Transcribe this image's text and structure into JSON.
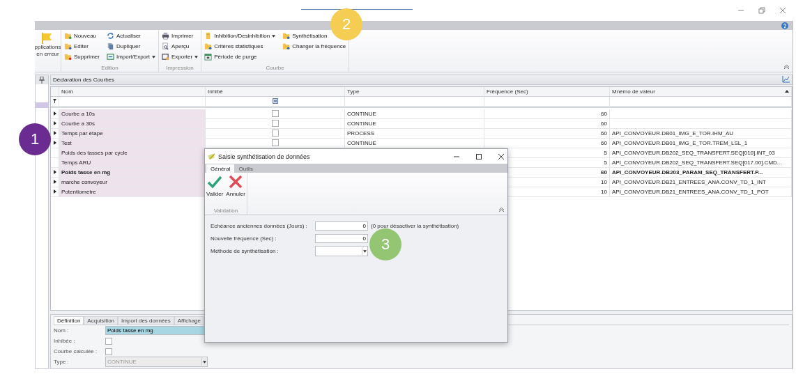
{
  "ribbon": {
    "left_button": {
      "lines": [
        "pplications",
        "en erreur"
      ]
    },
    "groups": [
      {
        "label": "Edition",
        "columns": [
          [
            {
              "label": "Nouveau",
              "dropdown": false
            },
            {
              "label": "Editer",
              "dropdown": false
            },
            {
              "label": "Supprimer",
              "dropdown": false
            }
          ],
          [
            {
              "label": "Actualiser",
              "dropdown": false
            },
            {
              "label": "Dupliquer",
              "dropdown": false
            },
            {
              "label": "Import/Export",
              "dropdown": true
            }
          ]
        ]
      },
      {
        "label": "Impression",
        "columns": [
          [
            {
              "label": "Imprimer",
              "dropdown": false
            },
            {
              "label": "Aperçu",
              "dropdown": false
            },
            {
              "label": "Exporter",
              "dropdown": true
            }
          ]
        ]
      },
      {
        "label": "Courbe",
        "columns": [
          [
            {
              "label": "Inhibition/Desinhibition",
              "dropdown": true
            },
            {
              "label": "Critères statistiques",
              "dropdown": false
            },
            {
              "label": "Période de purge",
              "dropdown": false
            }
          ],
          [
            {
              "label": "Synthétisation",
              "dropdown": false
            },
            {
              "label": "Changer la fréquence",
              "dropdown": false
            }
          ]
        ]
      }
    ]
  },
  "panel": {
    "title": "Déclaration des Courbes"
  },
  "grid": {
    "columns": [
      "Nom",
      "Inhibé",
      "Type",
      "Fréquence (Sec)",
      "Mnémo de valeur"
    ],
    "rows": [
      {
        "name": "Courbe a 10s",
        "expandable": true,
        "selected": false,
        "inhibited": false,
        "type": "CONTINUE",
        "frequency": "60"
      },
      {
        "name": "Courbe a 30s",
        "expandable": true,
        "selected": false,
        "inhibited": false,
        "type": "CONTINUE",
        "frequency": "60"
      },
      {
        "name": "Temps par étape",
        "expandable": true,
        "selected": false,
        "inhibited": false,
        "type": "PROCESS",
        "frequency": "60",
        "mnemo": "API_CONVOYEUR.DB01_IMG_E_TOR.IHM_AU"
      },
      {
        "name": "Test",
        "expandable": true,
        "selected": false,
        "inhibited": false,
        "type": "CONTINUE",
        "frequency": "60",
        "mnemo": "API_CONVOYEUR.DB01_IMG_E_TOR.TREM_LSL_1"
      },
      {
        "name": "Poids des tasses par cycle",
        "expandable": false,
        "selected": false,
        "frequency": "5",
        "mnemo": "API_CONVOYEUR.DB202_SEQ_TRANSFERT.SEQ[010].INT_03"
      },
      {
        "name": "Temps ARU",
        "expandable": false,
        "selected": false,
        "frequency": "5",
        "mnemo": "API_CONVOYEUR.DB202_SEQ_TRANSFERT.SEQ[017.00].CMD..."
      },
      {
        "name": "Poids tasse en mg",
        "expandable": true,
        "selected": true,
        "frequency": "60",
        "mnemo": "API_CONVOYEUR.DB203_PARAM_SEQ_TRANSFERT.P..."
      },
      {
        "name": "marche convoyeur",
        "expandable": true,
        "selected": false,
        "frequency": "10",
        "mnemo": "API_CONVOYEUR.DB21_ENTREES_ANA.CONV_TD_1_INT"
      },
      {
        "name": "Potentiometre",
        "expandable": true,
        "selected": false,
        "frequency": "10",
        "mnemo": "API_CONVOYEUR.DB21_ENTREES_ANA.CONV_TD_1_POT"
      }
    ]
  },
  "details": {
    "tabs": [
      {
        "label": "Définition",
        "selected": true
      },
      {
        "label": "Acquisition",
        "selected": false
      },
      {
        "label": "Import des données",
        "selected": false
      },
      {
        "label": "Affichage",
        "selected": false
      }
    ],
    "fields": [
      {
        "kind": "text",
        "label": "Nom :",
        "value": "Poids tasse en mg"
      },
      {
        "kind": "checkbox",
        "label": "Inhibée :",
        "checked": false
      },
      {
        "kind": "checkbox",
        "label": "Courbe calculée :",
        "checked": false
      },
      {
        "kind": "combo",
        "label": "Type :",
        "value": "CONTINUE",
        "disabled": true
      }
    ]
  },
  "dialog": {
    "title": "Saisie synthétisation de données",
    "tabs": [
      {
        "label": "Général",
        "selected": true
      },
      {
        "label": "Outils",
        "selected": false
      }
    ],
    "buttons": [
      {
        "label": "Valider",
        "kind": "ok"
      },
      {
        "label": "Annuler",
        "kind": "cancel"
      }
    ],
    "group_label": "Validation",
    "fields": [
      {
        "kind": "number",
        "label": "Echéance anciennes données (Jours) :",
        "value": "0",
        "note": "(0 pour désactiver la synthétisation)"
      },
      {
        "kind": "number",
        "label": "Nouvelle fréquence (Sec) :",
        "value": "0"
      },
      {
        "kind": "combo",
        "label": "Méthode de synthétisation :"
      }
    ]
  },
  "badges": [
    {
      "text": "1",
      "color": "#6a2c91"
    },
    {
      "text": "2",
      "color": "#f4cd52"
    },
    {
      "text": "3",
      "color": "#93c572"
    }
  ]
}
